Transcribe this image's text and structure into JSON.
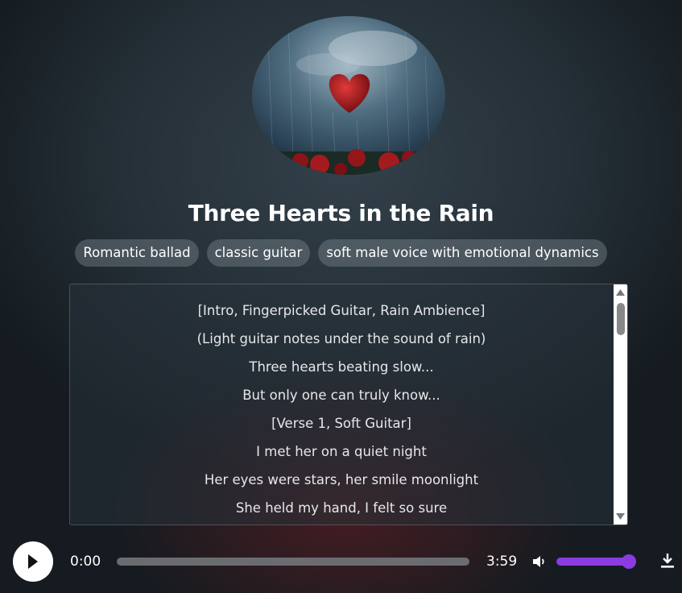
{
  "song": {
    "title": "Three Hearts in the Rain",
    "tags": [
      "Romantic ballad",
      "classic guitar",
      "soft male voice with emotional dynamics"
    ]
  },
  "lyrics": [
    "[Intro, Fingerpicked Guitar, Rain Ambience]",
    "(Light guitar notes under the sound of rain)",
    "Three hearts beating slow...",
    "But only one can truly know...",
    "[Verse 1, Soft Guitar]",
    "I met her on a quiet night",
    "Her eyes were stars, her smile moonlight",
    "She held my hand, I felt so sure"
  ],
  "player": {
    "current_time": "0:00",
    "duration": "3:59",
    "progress_fraction": 0,
    "volume_fraction": 1.0
  },
  "colors": {
    "accent": "#8a3ce0",
    "background": "#253038"
  },
  "icons": {
    "play": "play-icon",
    "volume": "volume-icon",
    "download": "download-icon"
  }
}
